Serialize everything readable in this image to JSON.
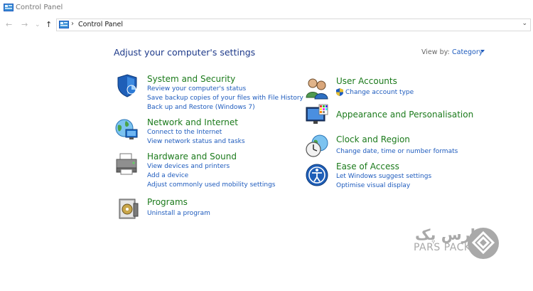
{
  "window": {
    "title": "Control Panel"
  },
  "nav": {
    "back": "←",
    "forward": "→",
    "recent": "⌄",
    "up": "↑"
  },
  "address": {
    "separator": "›",
    "path": "Control Panel",
    "dropdown": "⌄"
  },
  "header": {
    "title": "Adjust your computer's settings",
    "view_by_label": "View by:",
    "view_by_value": "Category"
  },
  "categories": [
    {
      "title": "System and Security",
      "links": [
        "Review your computer's status",
        "Save backup copies of your files with File History",
        "Back up and Restore (Windows 7)"
      ]
    },
    {
      "title": "Network and Internet",
      "links": [
        "Connect to the Internet",
        "View network status and tasks"
      ]
    },
    {
      "title": "Hardware and Sound",
      "links": [
        "View devices and printers",
        "Add a device",
        "Adjust commonly used mobility settings"
      ]
    },
    {
      "title": "Programs",
      "links": [
        "Uninstall a program"
      ]
    },
    {
      "title": "User Accounts",
      "links": [
        "Change account type"
      ]
    },
    {
      "title": "Appearance and Personalisation",
      "links": []
    },
    {
      "title": "Clock and Region",
      "links": [
        "Change date, time or number formats"
      ]
    },
    {
      "title": "Ease of Access",
      "links": [
        "Let Windows suggest settings",
        "Optimise visual display"
      ]
    }
  ],
  "watermark": {
    "persian": "پارس پک",
    "latin": "PARS PACK"
  },
  "colors": {
    "heading": "#1e3a8a",
    "category_title": "#1b7a1b",
    "link": "#1e5bbd"
  }
}
